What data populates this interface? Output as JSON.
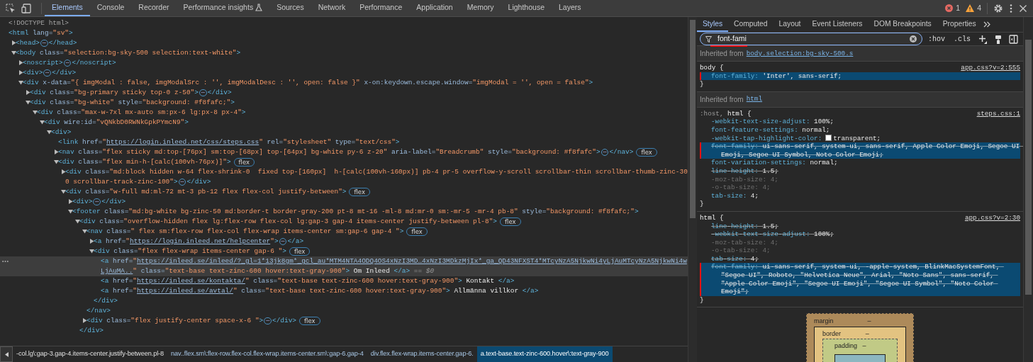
{
  "toolbar": {
    "tabs": [
      {
        "label": "Elements",
        "selected": true,
        "experimental": false
      },
      {
        "label": "Console",
        "selected": false,
        "experimental": false
      },
      {
        "label": "Recorder",
        "selected": false,
        "experimental": false
      },
      {
        "label": "Performance insights",
        "selected": false,
        "experimental": true
      },
      {
        "label": "Sources",
        "selected": false,
        "experimental": false
      },
      {
        "label": "Network",
        "selected": false,
        "experimental": false
      },
      {
        "label": "Performance",
        "selected": false,
        "experimental": false
      },
      {
        "label": "Application",
        "selected": false,
        "experimental": false
      },
      {
        "label": "Memory",
        "selected": false,
        "experimental": false
      },
      {
        "label": "Lighthouse",
        "selected": false,
        "experimental": false
      },
      {
        "label": "Layers",
        "selected": false,
        "experimental": false
      }
    ],
    "errors": "1",
    "warnings": "4"
  },
  "dom_tree": [
    {
      "parts": [
        {
          "doctype": "<!DOCTYPE html>"
        }
      ],
      "selected": false
    },
    {
      "parts": [
        {
          "tag": "<html"
        },
        {
          "attr": " lang="
        },
        {
          "value": "\"sv\""
        },
        {
          "tag": ">"
        }
      ],
      "selected": false,
      "children": [
        {
          "parts": [
            {
              "tag": "<head>"
            },
            {
              "more": "⋯"
            },
            {
              "tag": "</head>"
            }
          ],
          "expanded": false,
          "selected": false
        },
        {
          "parts": [
            {
              "tag": "<body"
            },
            {
              "attr": " class="
            },
            {
              "value": "\"selection:bg-sky-500 selection:text-white\""
            },
            {
              "tag": ">"
            }
          ],
          "expanded": true,
          "selected": false,
          "children": [
            {
              "parts": [
                {
                  "tag": "<noscript>"
                },
                {
                  "more": "⋯"
                },
                {
                  "tag": "</noscript>"
                }
              ],
              "expanded": false,
              "selected": false
            },
            {
              "parts": [
                {
                  "tag": "<div>"
                },
                {
                  "more": "⋯"
                },
                {
                  "tag": "</div>"
                }
              ],
              "expanded": false,
              "selected": false
            },
            {
              "parts": [
                {
                  "tag": "<div"
                },
                {
                  "attr": " x-data="
                },
                {
                  "value": "\"{ imgModal : false, imgModalSrc : '', imgModalDesc : '', open: false }\""
                },
                {
                  "attr": " x-on:keydown.escape.window="
                },
                {
                  "value": "\"imgModal = '', open = false\""
                },
                {
                  "tag": ">"
                }
              ],
              "expanded": true,
              "selected": false,
              "children": [
                {
                  "parts": [
                    {
                      "tag": "<div"
                    },
                    {
                      "attr": " class="
                    },
                    {
                      "value": "\"bg-primary sticky top-0 z-50\""
                    },
                    {
                      "tag": ">"
                    },
                    {
                      "more": "⋯"
                    },
                    {
                      "tag": "</div>"
                    }
                  ],
                  "expanded": false,
                  "selected": false
                },
                {
                  "parts": [
                    {
                      "tag": "<div"
                    },
                    {
                      "attr": " class="
                    },
                    {
                      "value": "\"bg-white\""
                    },
                    {
                      "attr": " style="
                    },
                    {
                      "value": "\"background: #f8fafc;\""
                    },
                    {
                      "tag": ">"
                    }
                  ],
                  "expanded": true,
                  "selected": false,
                  "children": [
                    {
                      "parts": [
                        {
                          "tag": "<div"
                        },
                        {
                          "attr": " class="
                        },
                        {
                          "value": "\"max-w-7xl mx-auto sm:px-6 lg:px-8 px-4\""
                        },
                        {
                          "tag": ">"
                        }
                      ],
                      "expanded": true,
                      "selected": false,
                      "children": [
                        {
                          "parts": [
                            {
                              "tag": "<div"
                            },
                            {
                              "attr": " wire:id="
                            },
                            {
                              "value": "\"vQNkbD0RWNkGpkPYmcN9\""
                            },
                            {
                              "tag": ">"
                            }
                          ],
                          "expanded": true,
                          "selected": false,
                          "children": [
                            {
                              "parts": [
                                {
                                  "tag": "<div>"
                                }
                              ],
                              "expanded": true,
                              "selected": false,
                              "children": [
                                {
                                  "parts": [
                                    {
                                      "tag": "<link"
                                    },
                                    {
                                      "attr": " href="
                                    },
                                    {
                                      "value": "\""
                                    },
                                    {
                                      "link": "https://login.inleed.net/css/steps.css"
                                    },
                                    {
                                      "value": "\""
                                    },
                                    {
                                      "attr": " rel="
                                    },
                                    {
                                      "value": "\"stylesheet\""
                                    },
                                    {
                                      "attr": " type="
                                    },
                                    {
                                      "value": "\"text/css\""
                                    },
                                    {
                                      "tag": ">"
                                    }
                                  ],
                                  "selected": false
                                },
                                {
                                  "parts": [
                                    {
                                      "tag": "<nav"
                                    },
                                    {
                                      "attr": " class="
                                    },
                                    {
                                      "value": "\"flex sticky md:top-[76px] sm:top-[68px] top-[64px] bg-white py-6 z-20\""
                                    },
                                    {
                                      "attr": " aria-label="
                                    },
                                    {
                                      "value": "\"Breadcrumb\""
                                    },
                                    {
                                      "attr": " style="
                                    },
                                    {
                                      "value": "\"background: #f8fafc\""
                                    },
                                    {
                                      "tag": ">"
                                    },
                                    {
                                      "more": "⋯"
                                    },
                                    {
                                      "tag": "</nav>"
                                    }
                                  ],
                                  "expanded": false,
                                  "selected": false,
                                  "badge": "flex"
                                },
                                {
                                  "parts": [
                                    {
                                      "tag": "<div"
                                    },
                                    {
                                      "attr": " class="
                                    },
                                    {
                                      "value": "\"flex min-h-[calc(100vh-76px)]\""
                                    },
                                    {
                                      "tag": ">"
                                    }
                                  ],
                                  "expanded": true,
                                  "selected": false,
                                  "badge": "flex",
                                  "children": [
                                    {
                                      "parts": [
                                        {
                                          "tag": "<div"
                                        },
                                        {
                                          "attr": " class="
                                        },
                                        {
                                          "value": "\"md:block hidden w-64 flex-shrink-0  fixed top-[160px]  h-[calc(100vh-160px)] pb-4 pr-5 overflow-y-scroll scrollbar-thin scrollbar-thumb-zinc-300 scrollbar-track-zinc-100\""
                                        },
                                        {
                                          "tag": ">"
                                        },
                                        {
                                          "more": "⋯"
                                        },
                                        {
                                          "tag": "</div>"
                                        }
                                      ],
                                      "expanded": false,
                                      "selected": false
                                    },
                                    {
                                      "parts": [
                                        {
                                          "tag": "<div"
                                        },
                                        {
                                          "attr": " class="
                                        },
                                        {
                                          "value": "\"w-full md:ml-72 mt-3 pb-12 flex flex-col justify-between\""
                                        },
                                        {
                                          "tag": ">"
                                        }
                                      ],
                                      "expanded": true,
                                      "selected": false,
                                      "badge": "flex",
                                      "children": [
                                        {
                                          "parts": [
                                            {
                                              "tag": "<div>"
                                            },
                                            {
                                              "more": "⋯"
                                            },
                                            {
                                              "tag": "</div>"
                                            }
                                          ],
                                          "expanded": false,
                                          "selected": false
                                        },
                                        {
                                          "parts": [
                                            {
                                              "tag": "<footer"
                                            },
                                            {
                                              "attr": " class="
                                            },
                                            {
                                              "value": "\"md:bg-white bg-zinc-50 md:border-t border-gray-200 pt-8 mt-16 -ml-8 md:mr-0 sm:-mr-5 -mr-4 pb-8\""
                                            },
                                            {
                                              "attr": " style="
                                            },
                                            {
                                              "value": "\"background: #f8fafc;\""
                                            },
                                            {
                                              "tag": ">"
                                            }
                                          ],
                                          "expanded": true,
                                          "selected": false,
                                          "children": [
                                            {
                                              "parts": [
                                                {
                                                  "tag": "<div"
                                                },
                                                {
                                                  "attr": " class="
                                                },
                                                {
                                                  "value": "\"overflow-hidden flex lg:flex-row flex-col lg:gap-3 gap-4 items-center justify-between pl-8\""
                                                },
                                                {
                                                  "tag": ">"
                                                }
                                              ],
                                              "expanded": true,
                                              "selected": false,
                                              "badge": "flex",
                                              "close": "</div>",
                                              "children": [
                                                {
                                                  "parts": [
                                                    {
                                                      "tag": "<nav"
                                                    },
                                                    {
                                                      "attr": " class="
                                                    },
                                                    {
                                                      "value": "\" flex sm:flex-row flex-col flex-wrap items-center sm:gap-6 gap-4 \""
                                                    },
                                                    {
                                                      "tag": ">"
                                                    }
                                                  ],
                                                  "expanded": true,
                                                  "selected": false,
                                                  "badge": "flex",
                                                  "close": "</nav>",
                                                  "children": [
                                                    {
                                                      "parts": [
                                                        {
                                                          "tag": "<a"
                                                        },
                                                        {
                                                          "attr": " href="
                                                        },
                                                        {
                                                          "value": "\""
                                                        },
                                                        {
                                                          "link": "https://login.inleed.net/helpcenter"
                                                        },
                                                        {
                                                          "value": "\""
                                                        },
                                                        {
                                                          "tag": ">"
                                                        },
                                                        {
                                                          "more": "⋯"
                                                        },
                                                        {
                                                          "tag": "</a>"
                                                        }
                                                      ],
                                                      "expanded": false,
                                                      "selected": false
                                                    },
                                                    {
                                                      "parts": [
                                                        {
                                                          "tag": "<div"
                                                        },
                                                        {
                                                          "attr": " class="
                                                        },
                                                        {
                                                          "value": "\"flex flex-wrap items-center gap-6 \""
                                                        },
                                                        {
                                                          "tag": ">"
                                                        }
                                                      ],
                                                      "expanded": true,
                                                      "selected": false,
                                                      "badge": "flex",
                                                      "close": "</div>",
                                                      "children": [
                                                        {
                                                          "parts": [
                                                            {
                                                              "tag": "<a"
                                                            },
                                                            {
                                                              "attr": " href="
                                                            },
                                                            {
                                                              "value": "\""
                                                            },
                                                            {
                                                              "link": "https://inleed.se/inleed/?_gl=1*13jk8gm*_gcl_au*MTM4NTA4ODQ4OS4xNzI3MD…4xNzI3MDkzMjIx*_ga_QD43NFXST4*MTcyNzA5NjkwNi4yLjAuMTcyNzA5NjkwNi4wLjAuMA.."
                                                            },
                                                            {
                                                              "value": "\""
                                                            },
                                                            {
                                                              "attr": " class="
                                                            },
                                                            {
                                                              "value": "\"text-base text-zinc-600 hover:text-gray-900\""
                                                            },
                                                            {
                                                              "tag": ">"
                                                            },
                                                            {
                                                              "text": " Om Inleed "
                                                            },
                                                            {
                                                              "tag": "</a>"
                                                            },
                                                            {
                                                              "ref": " == $0"
                                                            }
                                                          ],
                                                          "selected": true
                                                        },
                                                        {
                                                          "parts": [
                                                            {
                                                              "tag": "<a"
                                                            },
                                                            {
                                                              "attr": " href="
                                                            },
                                                            {
                                                              "value": "\""
                                                            },
                                                            {
                                                              "link": "https://inleed.se/kontakta/"
                                                            },
                                                            {
                                                              "value": "\""
                                                            },
                                                            {
                                                              "attr": " class="
                                                            },
                                                            {
                                                              "value": "\"text-base text-zinc-600 hover:text-gray-900\""
                                                            },
                                                            {
                                                              "tag": ">"
                                                            },
                                                            {
                                                              "text": " Kontakt "
                                                            },
                                                            {
                                                              "tag": "</a>"
                                                            }
                                                          ],
                                                          "selected": false
                                                        },
                                                        {
                                                          "parts": [
                                                            {
                                                              "tag": "<a"
                                                            },
                                                            {
                                                              "attr": " href="
                                                            },
                                                            {
                                                              "value": "\""
                                                            },
                                                            {
                                                              "link": "https://inleed.se/avtal/"
                                                            },
                                                            {
                                                              "value": "\""
                                                            },
                                                            {
                                                              "attr": " class="
                                                            },
                                                            {
                                                              "value": "\"text-base text-zinc-600 hover:text-gray-900\""
                                                            },
                                                            {
                                                              "tag": ">"
                                                            },
                                                            {
                                                              "text": " Allmänna villkor "
                                                            },
                                                            {
                                                              "tag": "</a>"
                                                            }
                                                          ],
                                                          "selected": false
                                                        }
                                                      ]
                                                    }
                                                  ]
                                                },
                                                {
                                                  "parts": [
                                                    {
                                                      "tag": "<div"
                                                    },
                                                    {
                                                      "attr": " class="
                                                    },
                                                    {
                                                      "value": "\"flex justify-center space-x-6 \""
                                                    },
                                                    {
                                                      "tag": ">"
                                                    },
                                                    {
                                                      "more": "⋯"
                                                    },
                                                    {
                                                      "tag": "</div>"
                                                    }
                                                  ],
                                                  "expanded": false,
                                                  "selected": false,
                                                  "badge": "flex"
                                                }
                                              ]
                                            }
                                          ]
                                        }
                                      ]
                                    }
                                  ]
                                }
                              ]
                            }
                          ]
                        }
                      ]
                    }
                  ]
                }
              ]
            }
          ]
        }
      ]
    }
  ],
  "breadcrumbs": [
    {
      "label": "-col.lg\\:gap-3.gap-4.items-center.justify-between.pl-8",
      "selected": false
    },
    {
      "label": "nav..flex.sm\\:flex-row.flex-col.flex-wrap.items-center.sm\\:gap-6.gap-4",
      "selected": false
    },
    {
      "label": "div.flex.flex-wrap.items-center.gap-6.",
      "selected": false
    },
    {
      "label": "a.text-base.text-zinc-600.hover\\:text-gray-900",
      "selected": true
    }
  ],
  "styles_panel": {
    "tabs": [
      {
        "label": "Styles",
        "selected": true
      },
      {
        "label": "Computed",
        "selected": false
      },
      {
        "label": "Layout",
        "selected": false
      },
      {
        "label": "Event Listeners",
        "selected": false
      },
      {
        "label": "DOM Breakpoints",
        "selected": false
      },
      {
        "label": "Properties",
        "selected": false
      }
    ],
    "filter": {
      "value": "font-fami",
      "annotated": true
    },
    "buttons": [
      ":hov",
      ".cls"
    ],
    "sections": [
      {
        "kind": "inherited",
        "label": "Inherited from",
        "link": "body.selection:bg-sky-500.s"
      },
      {
        "kind": "rule",
        "selector": [
          {
            "text": "body",
            "matched": true
          }
        ],
        "open": " {",
        "source": "app.css?v=2:555",
        "close": "}",
        "declarations": [
          {
            "name": "font-family:",
            "value": " 'Inter', sans-serif;",
            "overridden": false,
            "inactive": false,
            "highlighted": true,
            "annotated": true
          }
        ]
      },
      {
        "kind": "inherited",
        "label": "Inherited from",
        "link": "html"
      },
      {
        "kind": "rule",
        "selector": [
          {
            "text": ":host, ",
            "matched": false
          },
          {
            "text": "html",
            "matched": true
          }
        ],
        "open": " {",
        "source": "steps.css:1",
        "close": "}",
        "declarations": [
          {
            "name": "-webkit-text-size-adjust:",
            "value": " 100%;",
            "overridden": false,
            "inactive": false,
            "highlighted": false,
            "annotated": false
          },
          {
            "name": "font-feature-settings:",
            "value": " normal;",
            "overridden": false,
            "inactive": false,
            "highlighted": false,
            "annotated": false
          },
          {
            "name": "-webkit-tap-highlight-color:",
            "value": "transparent;",
            "overridden": false,
            "inactive": false,
            "highlighted": false,
            "annotated": false,
            "swatch": true
          },
          {
            "name": "font-family:",
            "value": " ui-sans-serif, system-ui, sans-serif, Apple Color Emoji, Segoe UI Emoji, Segoe UI Symbol, Noto Color Emoji;",
            "overridden": true,
            "inactive": false,
            "highlighted": true,
            "annotated": true
          },
          {
            "name": "font-variation-settings:",
            "value": " normal;",
            "overridden": false,
            "inactive": false,
            "highlighted": false,
            "annotated": false
          },
          {
            "name": "line-height:",
            "value": " 1.5;",
            "overridden": true,
            "inactive": false,
            "highlighted": false,
            "annotated": false
          },
          {
            "name": "-moz-tab-size:",
            "value": " 4;",
            "overridden": false,
            "inactive": true,
            "highlighted": false,
            "annotated": false
          },
          {
            "name": "-o-tab-size:",
            "value": " 4;",
            "overridden": false,
            "inactive": true,
            "highlighted": false,
            "annotated": false
          },
          {
            "name": "tab-size:",
            "value": " 4;",
            "overridden": false,
            "inactive": false,
            "highlighted": false,
            "annotated": false
          }
        ]
      },
      {
        "kind": "rule",
        "selector": [
          {
            "text": "html",
            "matched": true
          }
        ],
        "open": " {",
        "source": "app.css?v=2:30",
        "close": "}",
        "declarations": [
          {
            "name": "line-height:",
            "value": " 1.5;",
            "overridden": true,
            "inactive": false,
            "highlighted": false,
            "annotated": false
          },
          {
            "name": "-webkit-text-size-adjust:",
            "value": " 100%;",
            "overridden": true,
            "inactive": false,
            "highlighted": false,
            "annotated": false
          },
          {
            "name": "-moz-tab-size:",
            "value": " 4;",
            "overridden": false,
            "inactive": true,
            "highlighted": false,
            "annotated": false
          },
          {
            "name": "-o-tab-size:",
            "value": " 4;",
            "overridden": false,
            "inactive": true,
            "highlighted": false,
            "annotated": false
          },
          {
            "name": "tab-size:",
            "value": " 4;",
            "overridden": true,
            "inactive": false,
            "highlighted": false,
            "annotated": false
          },
          {
            "name": "font-family:",
            "value": " ui-sans-serif, system-ui, -apple-system, BlinkMacSystemFont, \"Segoe UI\", Roboto, \"Helvetica Neue\", Arial, \"Noto Sans\", sans-serif, \"Apple Color Emoji\", \"Segoe UI Emoji\", \"Segoe UI Symbol\", \"Noto Color Emoji\";",
            "overridden": true,
            "inactive": false,
            "highlighted": true,
            "annotated": true
          }
        ]
      }
    ],
    "box_model": {
      "margin": {
        "label": "margin",
        "value": "–"
      },
      "border": {
        "label": "border",
        "value": "–"
      },
      "padding": {
        "label": "padding",
        "value": "–"
      }
    }
  }
}
